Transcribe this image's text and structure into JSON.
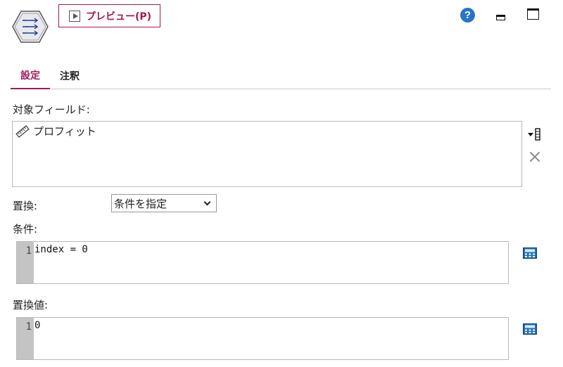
{
  "toolbar": {
    "node_icon": "filler-node-icon",
    "preview_label": "プレビュー(P)",
    "help_icon": "help-icon",
    "help_glyph": "?",
    "minimize_icon": "minimize-icon",
    "maximize_icon": "maximize-icon",
    "accent_color": "#a0195a"
  },
  "tabs": [
    {
      "label": "設定",
      "active": true
    },
    {
      "label": "注釈",
      "active": false
    }
  ],
  "fields": {
    "label": "対象フィールド:",
    "items": [
      {
        "name": "プロフィット",
        "icon": "ruler-icon"
      }
    ],
    "pick_icon": "field-picker-icon",
    "delete_icon": "delete-icon"
  },
  "replace": {
    "label": "置換:",
    "selected": "条件を指定"
  },
  "condition": {
    "label": "条件:",
    "line_number": "1",
    "code": "index = 0",
    "calc_icon": "expression-builder-icon"
  },
  "replace_value": {
    "label": "置換値:",
    "line_number": "1",
    "code": "0",
    "calc_icon": "expression-builder-icon"
  }
}
